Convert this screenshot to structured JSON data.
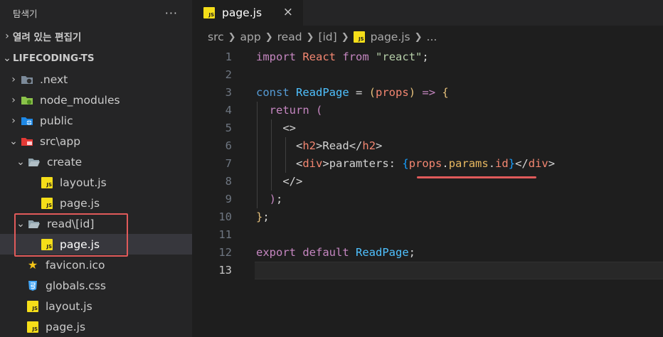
{
  "colors": {
    "sidebar_bg": "#252526",
    "editor_bg": "#1e1e1e",
    "highlight": "#e05a5a",
    "js_badge": "#f5de19"
  },
  "sidebar": {
    "title": "탐색기",
    "more_icon": "ellipsis-icon",
    "open_editors_label": "열려 있는 편집기",
    "project_label": "LIFECODING-TS",
    "tree": [
      {
        "label": ".next",
        "icon": "folder-next-icon",
        "expanded": false
      },
      {
        "label": "node_modules",
        "icon": "folder-node-icon",
        "expanded": false
      },
      {
        "label": "public",
        "icon": "folder-public-icon",
        "expanded": false
      },
      {
        "label": "src\\app",
        "icon": "folder-src-icon",
        "expanded": true
      },
      {
        "label": "create",
        "icon": "folder-icon",
        "expanded": true
      },
      {
        "label": "layout.js",
        "icon": "js-file-icon"
      },
      {
        "label": "page.js",
        "icon": "js-file-icon"
      },
      {
        "label": "read\\[id]",
        "icon": "folder-open-icon",
        "expanded": true
      },
      {
        "label": "page.js",
        "icon": "js-file-icon",
        "selected": true
      },
      {
        "label": "favicon.ico",
        "icon": "star-icon"
      },
      {
        "label": "globals.css",
        "icon": "css-file-icon"
      },
      {
        "label": "layout.js",
        "icon": "js-file-icon"
      },
      {
        "label": "page.js",
        "icon": "js-file-icon"
      }
    ]
  },
  "editor": {
    "tab_label": "page.js",
    "tab_close": "×",
    "js_badge_text": "JS",
    "breadcrumbs": [
      "src",
      "app",
      "read",
      "[id]",
      "page.js",
      "..."
    ],
    "active_line": "13",
    "line_numbers": [
      "1",
      "2",
      "3",
      "4",
      "5",
      "6",
      "7",
      "8",
      "9",
      "10",
      "11",
      "12",
      "13"
    ],
    "code": {
      "l1": {
        "import": "import",
        "react": "React",
        "from": "from",
        "str": "\"react\"",
        "semi": ";"
      },
      "l3": {
        "const": "const",
        "name": "ReadPage",
        "eq": " = ",
        "lp": "(",
        "param": "props",
        "rp": ")",
        "arrow": " => ",
        "brace": "{"
      },
      "l4": {
        "return": "return",
        "paren": "("
      },
      "l5": {
        "frag": "<>"
      },
      "l6": {
        "open": "<",
        "tag": "h2",
        "close": ">",
        "text": "Read",
        "endopen": "</",
        "endtag": "h2",
        "endclose": ">"
      },
      "l7": {
        "open": "<",
        "tag": "div",
        "close": ">",
        "text": "paramters: ",
        "lb": "{",
        "p1": "props",
        "d1": ".",
        "p2": "params",
        "d2": ".",
        "p3": "id",
        "rb": "}",
        "endopen": "</",
        "endtag": "div",
        "endclose": ">"
      },
      "l8": {
        "frag": "</>"
      },
      "l9": {
        "paren": ")",
        "semi": ";"
      },
      "l10": {
        "brace": "}",
        "semi": ";"
      },
      "l12": {
        "export": "export",
        "default": "default",
        "name": "ReadPage",
        "semi": ";"
      }
    }
  }
}
